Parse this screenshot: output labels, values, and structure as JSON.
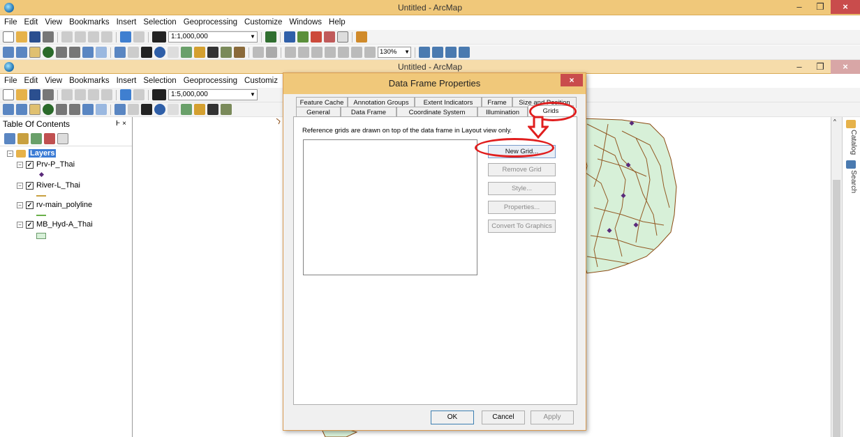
{
  "outer_window": {
    "title": "Untitled - ArcMap"
  },
  "inner_window": {
    "title": "Untitled - ArcMap"
  },
  "menu": [
    "File",
    "Edit",
    "View",
    "Bookmarks",
    "Insert",
    "Selection",
    "Geoprocessing",
    "Customize",
    "Windows",
    "Help"
  ],
  "inner_menu": [
    "File",
    "Edit",
    "View",
    "Bookmarks",
    "Insert",
    "Selection",
    "Geoprocessing",
    "Customiz"
  ],
  "outer_toolbar": {
    "scale": "1:1,000,000",
    "zoom": "130%"
  },
  "inner_toolbar": {
    "scale": "1:5,000,000"
  },
  "toc": {
    "title": "Table Of Contents",
    "pin": "Ͱ ×",
    "root": "Layers",
    "layers": [
      {
        "name": "Prv-P_Thai",
        "checked": "✓"
      },
      {
        "name": "River-L_Thai",
        "checked": "✓"
      },
      {
        "name": "rv-main_polyline",
        "checked": "✓"
      },
      {
        "name": "MB_Hyd-A_Thai",
        "checked": "✓"
      }
    ]
  },
  "side_tabs": {
    "catalog": "Catalog",
    "search": "Search"
  },
  "dialog": {
    "title": "Data Frame Properties",
    "close": "×",
    "tabs_row1": [
      "Feature Cache",
      "Annotation Groups",
      "Extent Indicators",
      "Frame",
      "Size and Position"
    ],
    "tabs_row2": [
      "General",
      "Data Frame",
      "Coordinate System",
      "Illumination",
      "Grids"
    ],
    "active_tab": "Grids",
    "panel_text": "Reference grids are drawn on top of the data frame in Layout view only.",
    "buttons": {
      "new_grid": "New Grid...",
      "remove_grid": "Remove Grid",
      "style": "Style...",
      "properties": "Properties...",
      "convert": "Convert To Graphics"
    },
    "footer": {
      "ok": "OK",
      "cancel": "Cancel",
      "apply": "Apply"
    }
  },
  "colors": {
    "titlebar": "#f0c87a",
    "river": "#8b4a12",
    "land": "#d7f0d8",
    "highlight": "#e01e1e"
  }
}
